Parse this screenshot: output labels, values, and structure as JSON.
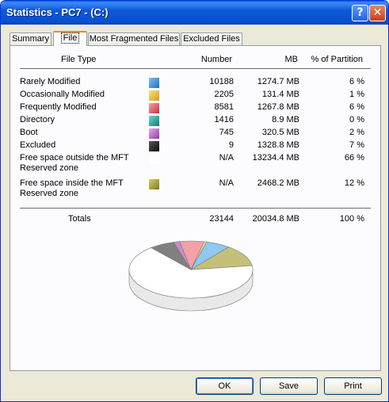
{
  "window": {
    "title": "Statistics - PC7 - (C:)",
    "help_glyph": "?",
    "close_glyph": "✕"
  },
  "tabs": [
    {
      "label": "Summary",
      "active": false
    },
    {
      "label": "File",
      "active": true
    },
    {
      "label": "Most Fragmented Files",
      "active": false
    },
    {
      "label": "Excluded Files",
      "active": false
    }
  ],
  "columns": {
    "file_type": "File Type",
    "number": "Number",
    "mb": "MB",
    "percent": "% of Partition"
  },
  "rows": [
    {
      "label": "Rarely Modified",
      "color": "#3a8fdc",
      "number": "10188",
      "mb": "1274.7 MB",
      "percent": "6 %"
    },
    {
      "label": "Occasionally Modified",
      "color": "#e8bd3a",
      "number": "2205",
      "mb": "131.4 MB",
      "percent": "1 %"
    },
    {
      "label": "Frequently Modified",
      "color": "#e25b6a",
      "number": "8581",
      "mb": "1267.8 MB",
      "percent": "6 %"
    },
    {
      "label": "Directory",
      "color": "#27a7a0",
      "number": "1416",
      "mb": "8.9 MB",
      "percent": "0 %"
    },
    {
      "label": "Boot",
      "color": "#b96bc4",
      "number": "745",
      "mb": "320.5 MB",
      "percent": "2 %"
    },
    {
      "label": "Excluded",
      "color": "#262626",
      "number": "9",
      "mb": "1328.8 MB",
      "percent": "7 %"
    },
    {
      "label": "Free space outside the MFT Reserved zone",
      "color": "#ffffff",
      "number": "N/A",
      "mb": "13234.4 MB",
      "percent": "66 %"
    },
    {
      "label": "Free space inside the MFT Reserved zone",
      "color": "#a9a335",
      "number": "N/A",
      "mb": "2468.2 MB",
      "percent": "12 %"
    }
  ],
  "totals": {
    "label": "Totals",
    "number": "23144",
    "mb": "20034.8 MB",
    "percent": "100 %"
  },
  "pie": {
    "slices": [
      {
        "name": "Free space outside the MFT Reserved zone",
        "value": 13234.4,
        "color": "#ffffff"
      },
      {
        "name": "Excluded",
        "value": 1328.8,
        "color": "#808080"
      },
      {
        "name": "Boot",
        "value": 320.5,
        "color": "#c58fcc"
      },
      {
        "name": "Frequently Modified",
        "value": 1267.8,
        "color": "#f3a0a8"
      },
      {
        "name": "Occasionally Modified",
        "value": 131.4,
        "color": "#f4dd8c"
      },
      {
        "name": "Rarely Modified",
        "value": 1274.7,
        "color": "#8fc8f0"
      },
      {
        "name": "Free space inside the MFT Reserved zone",
        "value": 2468.2,
        "color": "#c4c07a"
      }
    ]
  },
  "buttons": {
    "ok": "OK",
    "save": "Save",
    "print": "Print"
  }
}
